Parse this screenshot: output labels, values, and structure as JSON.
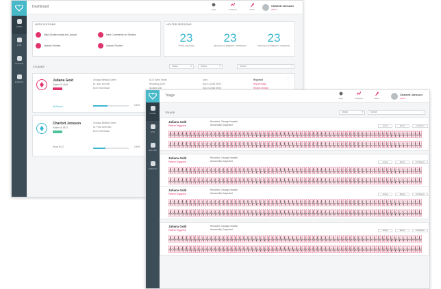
{
  "dashboard": {
    "title": "Dashboard",
    "sidebar": [
      {
        "label": "Home",
        "icon": "home-icon"
      },
      {
        "label": "Live",
        "icon": "live-icon"
      },
      {
        "label": "Holter",
        "icon": "holter-icon"
      },
      {
        "label": "Events",
        "icon": "heart-icon"
      }
    ],
    "toolbar": [
      {
        "label": "Help",
        "icon": "help-icon"
      },
      {
        "label": "Analytics",
        "icon": "analytics-icon"
      },
      {
        "label": "Alerts",
        "icon": "alerts-icon"
      }
    ],
    "user": {
      "name": "Charlott Jonsson",
      "role": "Admin"
    },
    "notifications": {
      "title": "Notifications",
      "items": [
        "New Studies ready for Upload",
        "New Comments on Studies",
        "Upload Studies",
        "Upload Studies"
      ]
    },
    "holter_sessions": {
      "title": "Holter Sessions",
      "stats": [
        {
          "value": "23",
          "caption": "Total Devices"
        },
        {
          "value": "23",
          "caption": "Devices Currently Working"
        },
        {
          "value": "23",
          "caption": "Devices Currently Working"
        }
      ]
    },
    "studies": {
      "title": "Studies",
      "filters": [
        "Status",
        "Status",
        "Search"
      ],
      "patients": [
        {
          "name": "Juliana Gold",
          "sub": "Patient ID 4548",
          "facility": [
            "Chicago Medical Center",
            "Dr. John Doe MD",
            "ECG Test Device"
          ],
          "details": [
            "ECG Event Series",
            "Recording 14/07",
            "Duration 24h",
            "Battery"
          ],
          "extra": [
            "Start",
            "Sep 14 2018 09:00",
            "Sep 15 2018 09:00"
          ],
          "status": "Reported",
          "statuslines": [
            "Report ready",
            "Review needed"
          ],
          "link": "My Report",
          "progress_label": "100%",
          "progress": 0.4
        },
        {
          "name": "Charlott Jonsson",
          "sub": "Patient ID 8872",
          "facility": [
            "Chicago Medical Center",
            "Dr. Paul Jones MD",
            "ECG Test Device"
          ],
          "link": "Study ECG",
          "progress_label": "100%",
          "progress": 0.35
        }
      ]
    }
  },
  "triage": {
    "title": "Triage",
    "sidebar": [
      {
        "label": "Home",
        "icon": "home-icon"
      },
      {
        "label": "Live",
        "icon": "live-icon"
      },
      {
        "label": "Holter",
        "icon": "holter-icon"
      },
      {
        "label": "Events",
        "icon": "heart-icon"
      }
    ],
    "toolbar": [
      {
        "label": "Help",
        "icon": "help-icon"
      },
      {
        "label": "Analytics",
        "icon": "analytics-icon"
      },
      {
        "label": "Alerts",
        "icon": "alerts-icon"
      }
    ],
    "user": {
      "name": "Charlott Jonsson",
      "role": "Admin"
    },
    "section": "Triage",
    "filters": [
      "Status",
      "Search"
    ],
    "buttons": [
      "Accept",
      "Reject",
      "Full Report"
    ],
    "events": [
      {
        "name": "Juliana Gold",
        "status": "Patient Triggered",
        "info1": "Recorded, Chicago Hospital",
        "info2": "Abnormality Suspected"
      },
      {
        "name": "Juliana Gold",
        "status": "Patient Triggered",
        "info1": "Recorded, Chicago Hospital",
        "info2": "Abnormality Suspected"
      },
      {
        "name": "Juliana Gold",
        "status": "Patient Triggered",
        "info1": "Recorded, Chicago Hospital",
        "info2": "Abnormality Suspected"
      },
      {
        "name": "Juliana Gold",
        "status": "Patient Triggered",
        "info1": "Recorded, Chicago Hospital",
        "info2": "Abnormality Suspected"
      }
    ]
  },
  "colors": {
    "sidebar": "#3d4d58",
    "accent": "#48b9c8",
    "alert": "#e0336b",
    "stat": "#3bb6d0"
  }
}
